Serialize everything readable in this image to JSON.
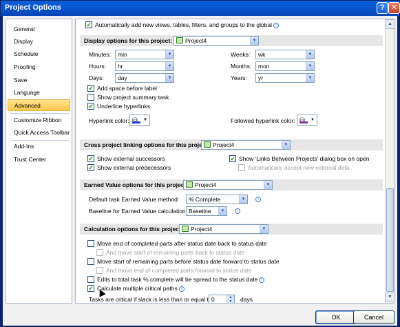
{
  "window": {
    "title": "Project Options",
    "help_label": "?",
    "close_label": "✕"
  },
  "sidebar": {
    "items": [
      {
        "label": "General"
      },
      {
        "label": "Display"
      },
      {
        "label": "Schedule"
      },
      {
        "label": "Proofing"
      },
      {
        "label": "Save"
      },
      {
        "label": "Language"
      },
      {
        "label": "Advanced",
        "selected": true
      },
      {
        "label": "Customize Ribbon"
      },
      {
        "label": "Quick Access Toolbar"
      },
      {
        "label": "Add-Ins"
      },
      {
        "label": "Trust Center"
      }
    ]
  },
  "top_row": {
    "label": "Automatically add new views, tables, filters, and groups to the global",
    "checked": true
  },
  "display": {
    "header": "Display options for this project:",
    "project": "Project4",
    "minutes_label": "Minutes:",
    "minutes_value": "min",
    "hours_label": "Hours:",
    "hours_value": "hr",
    "days_label": "Days:",
    "days_value": "day",
    "weeks_label": "Weeks:",
    "weeks_value": "wk",
    "months_label": "Months:",
    "months_value": "mon",
    "years_label": "Years:",
    "years_value": "yr",
    "add_space": {
      "label": "Add space before label",
      "checked": true
    },
    "show_summary": {
      "label": "Show project summary task",
      "checked": false
    },
    "underline": {
      "label": "Underline hyperlinks",
      "checked": true
    },
    "hyperlink_color_label": "Hyperlink color:",
    "followed_color_label": "Followed hyperlink color:"
  },
  "cross": {
    "header": "Cross project linking options for this project:",
    "project": "Project4",
    "show_successors": {
      "label": "Show external successors",
      "checked": true
    },
    "show_predecessors": {
      "label": "Show external predecessors",
      "checked": true
    },
    "show_links_dialog": {
      "label": "Show 'Links Between Projects' dialog box on open",
      "checked": true
    },
    "auto_accept": {
      "label": "Automatically accept new external data",
      "checked": false
    }
  },
  "earned": {
    "header": "Earned Value options for this project:",
    "project": "Project4",
    "default_method_label": "Default task Earned Value method:",
    "default_method_value": "% Complete",
    "baseline_label": "Baseline for Earned Value calculation:",
    "baseline_value": "Baseline"
  },
  "calc": {
    "header": "Calculation options for this project:",
    "project": "Project4",
    "move_end": {
      "label": "Move end of completed parts after status date back to status date",
      "checked": false
    },
    "move_start_remaining": {
      "label": "And move start of remaining parts back to status date",
      "checked": false
    },
    "move_start": {
      "label": "Move start of remaining parts before status date forward to status date",
      "checked": false
    },
    "move_end_completed": {
      "label": "And move end of completed parts forward to status date",
      "checked": false
    },
    "edits_total": {
      "label": "Edits to total task % complete will be spread to the status date",
      "checked": false
    },
    "multiple_critical": {
      "label": "Calculate multiple critical paths",
      "checked": true
    },
    "critical_slack_label": "Tasks are critical if slack is less than or equal to",
    "critical_slack_value": "0",
    "critical_slack_unit": "days"
  },
  "footer": {
    "ok_label": "OK",
    "cancel_label": "Cancel"
  },
  "colors": {
    "accent": "#0a5fd8",
    "selected_nav": "#ffd064",
    "hyperlink": "#1a3ec7"
  }
}
